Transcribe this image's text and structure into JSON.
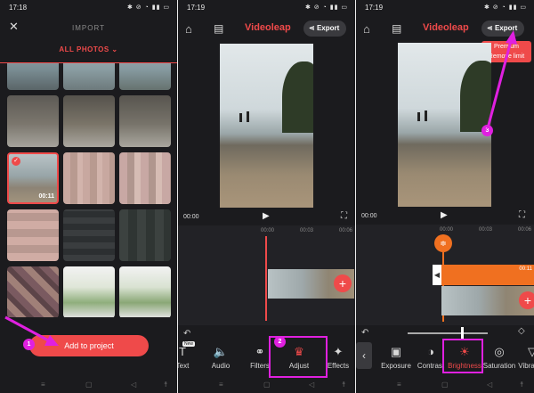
{
  "status_bar": {
    "time": "17:18",
    "time_2": "17:19",
    "time_3": "17:19",
    "icons": "✱ ⊘ ◔ ▮▮ ▭"
  },
  "import_panel": {
    "title": "IMPORT",
    "album_selector": "ALL PHOTOS",
    "selected_duration": "00:11",
    "add_button": "Add to project",
    "step_badge": "1"
  },
  "editor_panel": {
    "app_title": "Videoleap",
    "export_label": "Export",
    "time_current": "00:00",
    "ruler": [
      "00:00",
      "00:03",
      "00:06"
    ],
    "step_badge": "2",
    "tools": [
      {
        "label": "Text",
        "icon": "text-icon",
        "glyph": "T",
        "badge": "New"
      },
      {
        "label": "Audio",
        "icon": "audio-icon",
        "glyph": "🔈"
      },
      {
        "label": "Filters",
        "icon": "filters-icon",
        "glyph": "⚭"
      },
      {
        "label": "Adjust",
        "icon": "adjust-icon",
        "glyph": "♛"
      },
      {
        "label": "Effects",
        "icon": "effects-icon",
        "glyph": "✦"
      }
    ]
  },
  "adjust_panel": {
    "app_title": "Videoleap",
    "export_label": "Export",
    "tooltip": "Premium Remove limit",
    "tooltip_line1": "Premium",
    "tooltip_line2": "Remove limit",
    "time_current": "00:00",
    "ruler": [
      "00:00",
      "00:03",
      "00:06"
    ],
    "clip_duration": "00:11",
    "step_badge": "3",
    "tools": [
      {
        "label": "Exposure",
        "icon": "exposure-icon",
        "glyph": "▣"
      },
      {
        "label": "Contrast",
        "icon": "contrast-icon",
        "glyph": "◑"
      },
      {
        "label": "Brightness",
        "icon": "brightness-icon",
        "glyph": "☀"
      },
      {
        "label": "Saturation",
        "icon": "saturation-icon",
        "glyph": "◎"
      },
      {
        "label": "Vibrance",
        "icon": "vibrance-icon",
        "glyph": "▽"
      }
    ]
  },
  "colors": {
    "accent": "#ef4a4a",
    "highlight": "#e020e0",
    "clip_orange": "#f07020",
    "bg": "#1b1b1e"
  }
}
